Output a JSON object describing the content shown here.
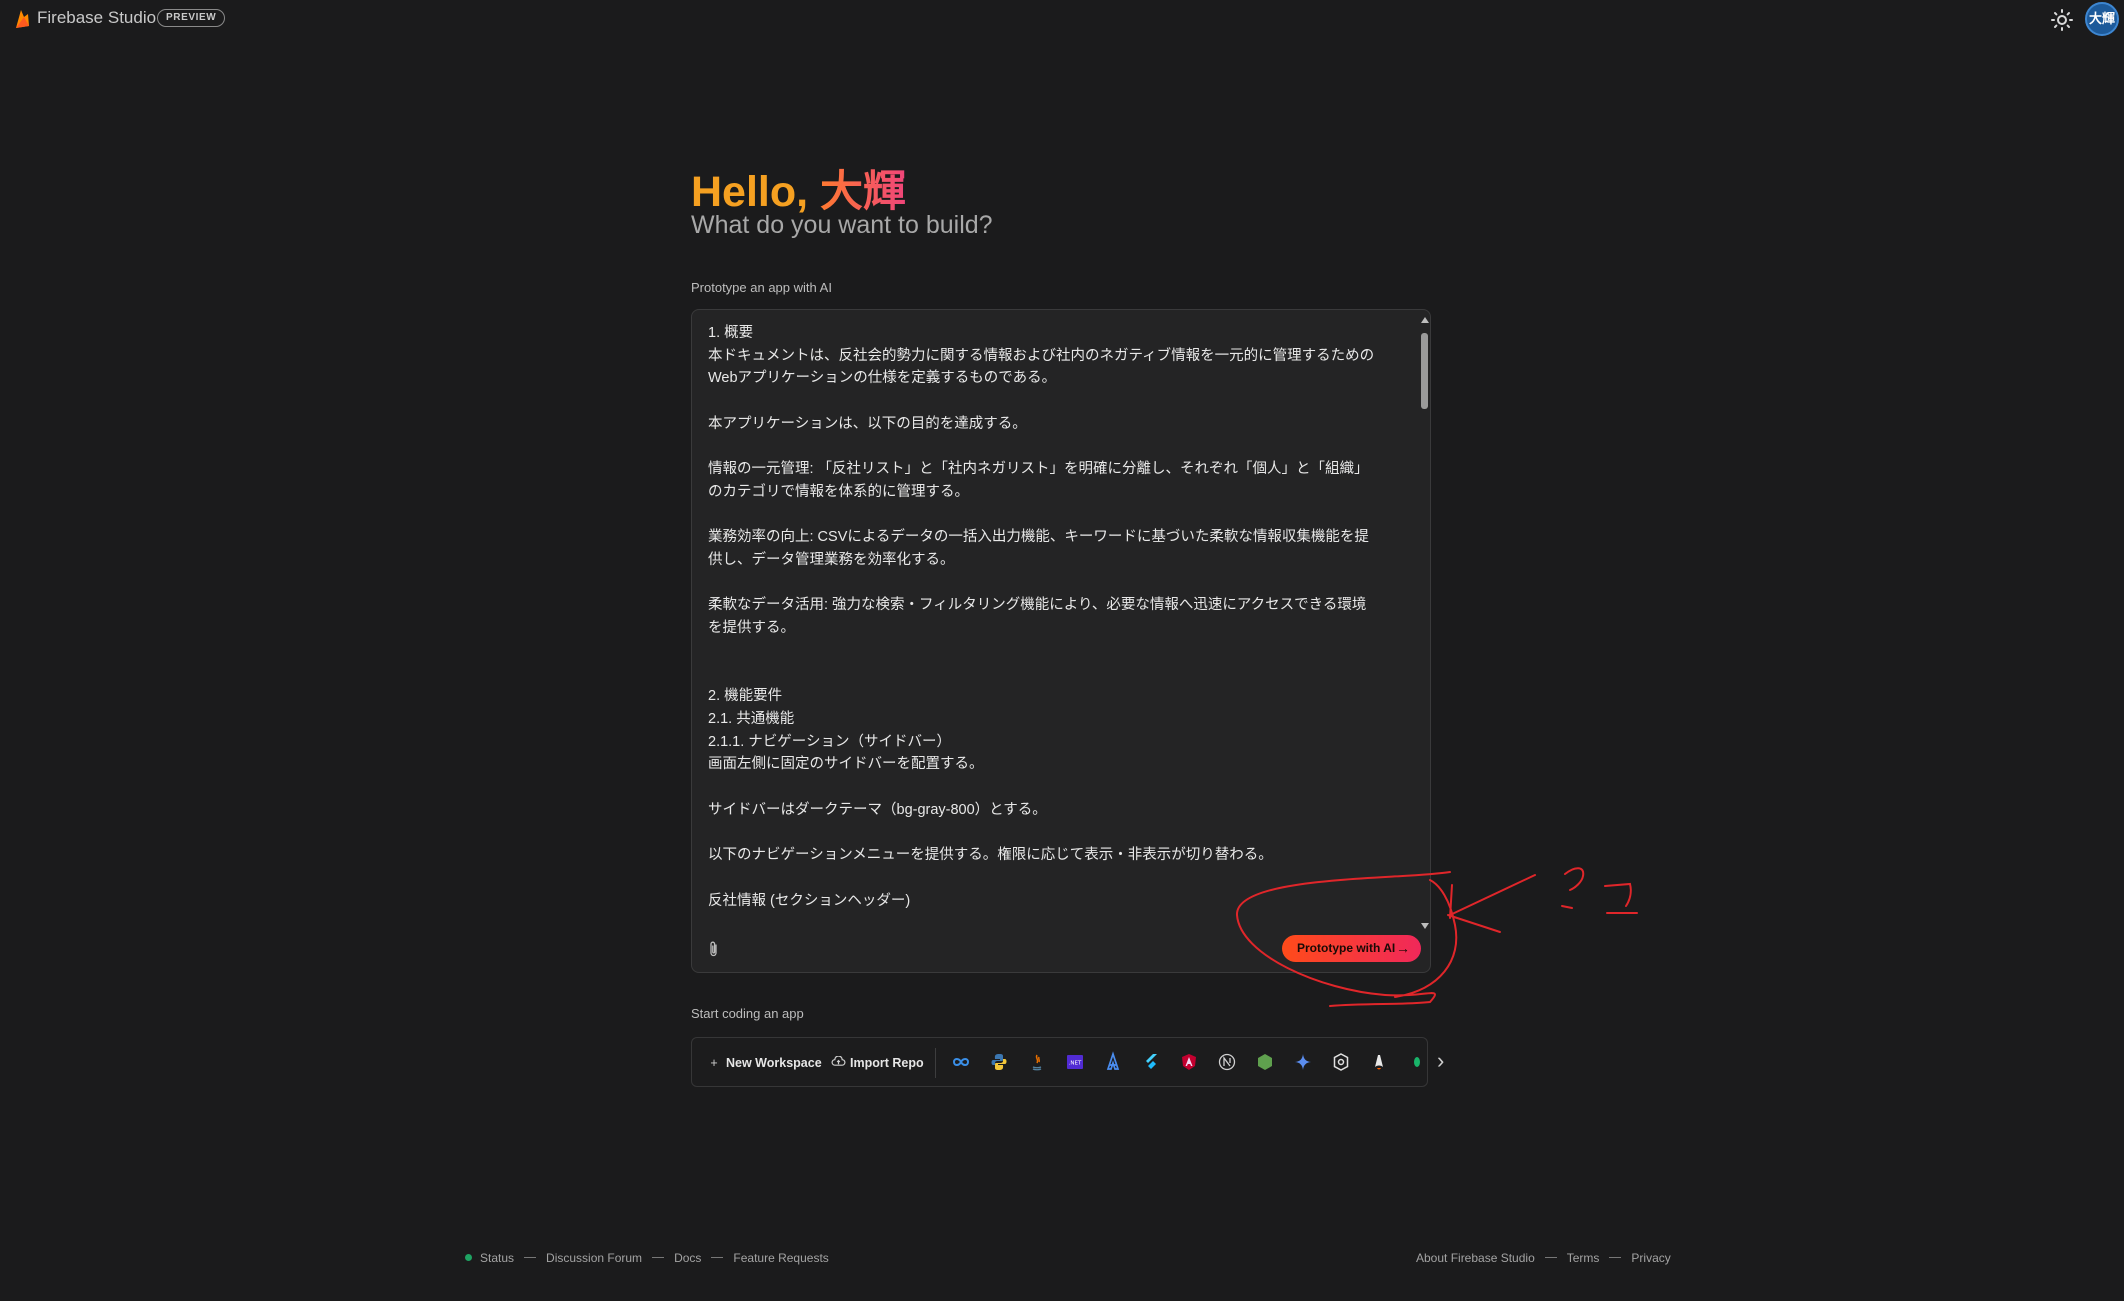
{
  "header": {
    "app_title": "Firebase Studio",
    "badge": "PREVIEW",
    "avatar_initials": "大輝",
    "theme_icon": "sun-icon",
    "logo_icon": "firebase-flame-icon"
  },
  "hero": {
    "greeting_hello": "Hello, ",
    "greeting_name": "大輝",
    "subheading": "What do you want to build?"
  },
  "prompt": {
    "section_label": "Prototype an app with AI",
    "text": "1. 概要\n本ドキュメントは、反社会的勢力に関する情報および社内のネガティブ情報を一元的に管理するための\nWebアプリケーションの仕様を定義するものである。\n\n本アプリケーションは、以下の目的を達成する。\n\n情報の一元管理: 「反社リスト」と「社内ネガリスト」を明確に分離し、それぞれ「個人」と「組織」\nのカテゴリで情報を体系的に管理する。\n\n業務効率の向上: CSVによるデータの一括入出力機能、キーワードに基づいた柔軟な情報収集機能を提\n供し、データ管理業務を効率化する。\n\n柔軟なデータ活用: 強力な検索・フィルタリング機能により、必要な情報へ迅速にアクセスできる環境\nを提供する。\n\n\n2. 機能要件\n2.1. 共通機能\n2.1.1. ナビゲーション（サイドバー）\n画面左側に固定のサイドバーを配置する。\n\nサイドバーはダークテーマ（bg-gray-800）とする。\n\n以下のナビゲーションメニューを提供する。権限に応じて表示・非表示が切り替わる。\n\n反社情報 (セクションヘッダー)",
    "button_label": "Prototype with AI",
    "button_arrow": "→",
    "attach_icon": "paperclip-icon"
  },
  "annotation": {
    "handwritten_note": "ここ",
    "color": "#e0262a"
  },
  "coding": {
    "section_label": "Start coding an app",
    "new_workspace": "New Workspace",
    "new_workspace_icon": "+",
    "import_repo": "Import Repo",
    "import_icon": "cloud-icon",
    "next_icon": "›",
    "templates": [
      "flutter-infinity-icon",
      "python-icon",
      "java-icon",
      ".NET-icon",
      "angular-icon",
      "flutter-icon",
      "angular-icon-2",
      "nextjs-icon",
      "nodejs-icon",
      "gemini-icon",
      "openai-icon",
      "astro-icon",
      "go-icon"
    ]
  },
  "footer": {
    "status": "Status",
    "forum": "Discussion Forum",
    "docs": "Docs",
    "feature_requests": "Feature Requests",
    "about": "About Firebase Studio",
    "terms": "Terms",
    "privacy": "Privacy"
  },
  "colors": {
    "background": "#1b1b1c",
    "accent_orange": "#f5a021",
    "button_gradient_start": "#ff4b1a",
    "button_gradient_end": "#f0285a",
    "status_green": "#1ea362"
  }
}
